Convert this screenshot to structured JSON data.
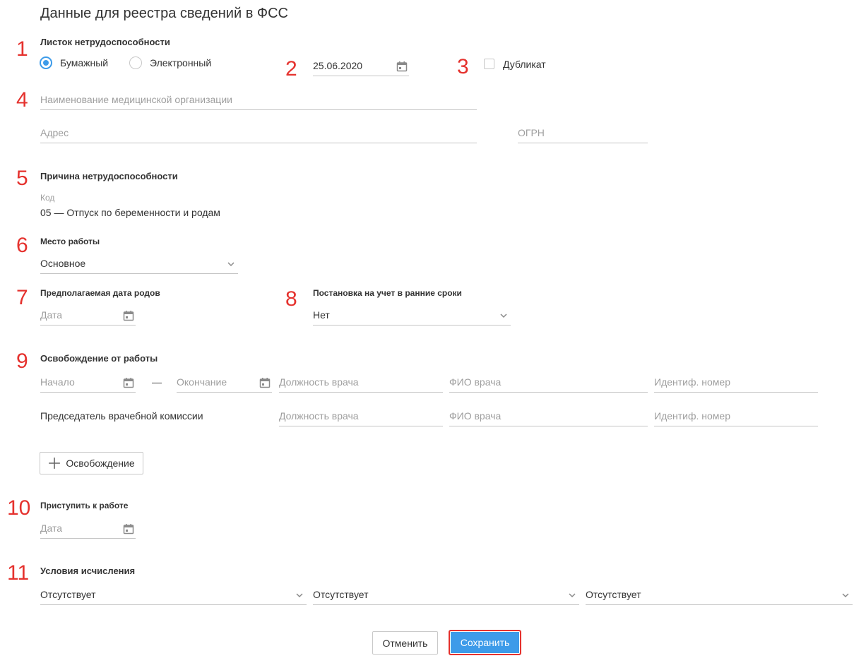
{
  "page": {
    "title": "Данные для реестра сведений в ФСС"
  },
  "markers": [
    "1",
    "2",
    "3",
    "4",
    "5",
    "6",
    "7",
    "8",
    "9",
    "10",
    "11"
  ],
  "sick_leave": {
    "heading": "Листок нетрудоспособности",
    "paper_label": "Бумажный",
    "electronic_label": "Электронный",
    "selected": "paper",
    "date_value": "25.06.2020",
    "duplicate_label": "Дубликат",
    "duplicate_checked": false
  },
  "organization": {
    "name_placeholder": "Наименование медицинской организации",
    "address_placeholder": "Адрес",
    "ogrn_placeholder": "ОГРН"
  },
  "reason": {
    "heading": "Причина нетрудоспособности",
    "code_label": "Код",
    "code_value": "05 — Отпуск по беременности и родам"
  },
  "workplace": {
    "heading": "Место работы",
    "value": "Основное"
  },
  "birth_date": {
    "heading": "Предполагаемая дата родов",
    "placeholder": "Дата"
  },
  "early_registration": {
    "heading": "Постановка на учет в ранние сроки",
    "value": "Нет"
  },
  "release": {
    "heading": "Освобождение от работы",
    "start_placeholder": "Начало",
    "dash": "—",
    "end_placeholder": "Окончание",
    "doctor_position_placeholder": "Должность врача",
    "doctor_name_placeholder": "ФИО врача",
    "doctor_id_placeholder": "Идентиф. номер",
    "chairman_label": "Председатель врачебной комиссии",
    "chairman_position_placeholder": "Должность врача",
    "chairman_name_placeholder": "ФИО врача",
    "chairman_id_placeholder": "Идентиф. номер",
    "add_button_label": "Освобождение"
  },
  "return_to_work": {
    "heading": "Приступить к работе",
    "placeholder": "Дата"
  },
  "calculation": {
    "heading": "Условия исчисления",
    "values": [
      "Отсутствует",
      "Отсутствует",
      "Отсутствует"
    ]
  },
  "actions": {
    "cancel_label": "Отменить",
    "save_label": "Сохранить"
  },
  "colors": {
    "accent": "#3d9be9",
    "marker": "#e5322e"
  }
}
